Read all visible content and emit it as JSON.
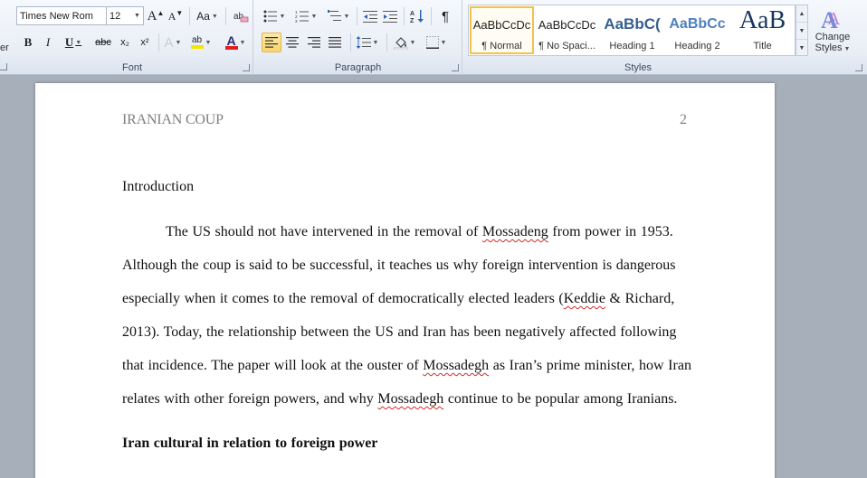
{
  "font_group": {
    "label": "Font",
    "font_name": "Times New Rom",
    "font_size": "12",
    "grow_font": "A",
    "shrink_font": "A",
    "change_case": "Aa",
    "bold": "B",
    "italic": "I",
    "underline": "U",
    "strikethrough": "abc",
    "subscript": "x₂",
    "superscript": "x²",
    "text_effects": "A",
    "highlight": "ab",
    "font_color": "A",
    "highlight_color": "#f4e600",
    "font_color_value": "#e02020"
  },
  "paragraph_group": {
    "label": "Paragraph",
    "show_marks": "¶"
  },
  "styles_group": {
    "label": "Styles",
    "tiles": [
      {
        "sample": "AaBbCcDc",
        "name": "¶ Normal"
      },
      {
        "sample": "AaBbCcDc",
        "name": "¶ No Spaci..."
      },
      {
        "sample": "AaBbC(",
        "name": "Heading 1"
      },
      {
        "sample": "AaBbCc",
        "name": "Heading 2"
      },
      {
        "sample": "AaB",
        "name": "Title"
      }
    ],
    "change_styles": "Change Styles",
    "heading_color": "#365f91",
    "heading2_color": "#4f81bd"
  },
  "left_edge_text": "er",
  "document": {
    "header_title": "IRANIAN COUP",
    "page_number": "2",
    "heading": "Introduction",
    "lines": [
      [
        {
          "t": "The US should not have intervened in the removal  of "
        },
        {
          "t": "Mossadeng",
          "err": true
        },
        {
          "t": " from power in 1953."
        }
      ],
      [
        {
          "t": "Although the coup is said to be successful, it teaches us why foreign intervention is dangerous"
        }
      ],
      [
        {
          "t": "especially when it comes to the removal  of democratically elected leaders ("
        },
        {
          "t": "Keddie",
          "err": true
        },
        {
          "t": " & Richard,"
        }
      ],
      [
        {
          "t": "2013). Today, the relationship between the US and Iran has been negatively affected following"
        }
      ],
      [
        {
          "t": "that incidence. The paper will look at the ouster of "
        },
        {
          "t": "Mossadegh",
          "err": true
        },
        {
          "t": " as Iran’s prime minister, how Iran"
        }
      ],
      [
        {
          "t": "relates with other foreign powers, and why "
        },
        {
          "t": "Mossadegh",
          "err": true
        },
        {
          "t": " continue to be popular among Iranians."
        }
      ]
    ],
    "subheading": "Iran cultural in relation to foreign power"
  }
}
